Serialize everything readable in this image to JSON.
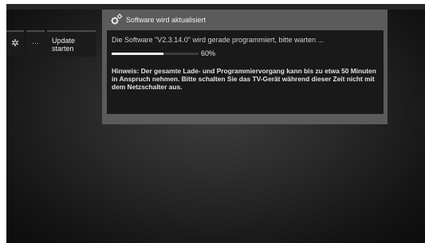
{
  "tiles": {
    "gear_icon": "gear-icon",
    "more_label": "···",
    "update_label": "Update starten"
  },
  "dialog": {
    "title": "Software wird aktualisiert",
    "status": "Die Software \"V2.3.14.0\" wird gerade programmiert, bitte warten ...",
    "progress_percent": 60,
    "progress_label": "60%",
    "hint": "Hinweis: Der gesamte Lade- und Programmiervorgang kann bis zu etwa 50 Minuten in Anspruch nehmen. Bitte schalten Sie das TV-Gerät während dieser Zeit nicht mit dem Netzschalter aus."
  },
  "colors": {
    "dialog_bg": "#5b5b5b",
    "dialog_body_bg": "#191919",
    "progress_fill": "#f2f2f2",
    "tv_background": "#2a2a2a"
  }
}
